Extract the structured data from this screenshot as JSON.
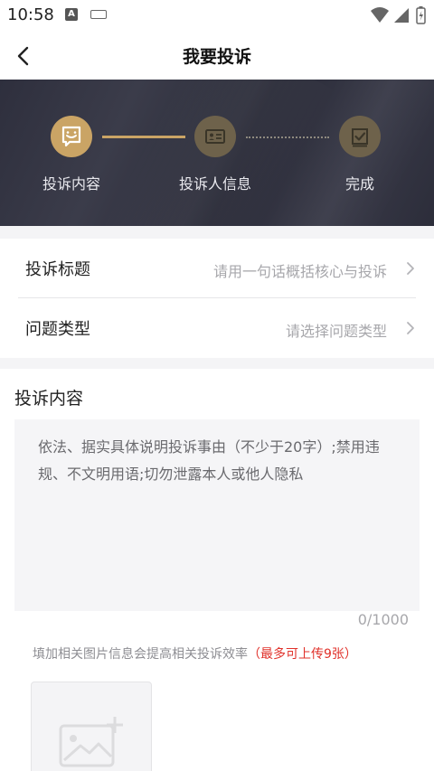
{
  "status_bar": {
    "time": "10:58",
    "a_badge": "A",
    "icons": [
      "a-badge-icon",
      "keyboard-icon",
      "wifi-icon",
      "signal-icon",
      "battery-icon"
    ]
  },
  "nav": {
    "title": "我要投诉",
    "back_icon": "chevron-left-icon"
  },
  "steps": [
    {
      "label": "投诉内容",
      "icon": "complaint-message-icon",
      "state": "active"
    },
    {
      "label": "投诉人信息",
      "icon": "id-card-icon",
      "state": "inactive"
    },
    {
      "label": "完成",
      "icon": "check-box-icon",
      "state": "inactive"
    }
  ],
  "form": {
    "title_row": {
      "label": "投诉标题",
      "placeholder": "请用一句话概括核心与投诉"
    },
    "type_row": {
      "label": "问题类型",
      "placeholder": "请选择问题类型"
    }
  },
  "content": {
    "section_title": "投诉内容",
    "textarea_placeholder": "依法、据实具体说明投诉事由（不少于20字）;禁用违规、不文明用语;切勿泄露本人或他人隐私",
    "textarea_value": "",
    "counter": "0/1000",
    "hint": "填加相关图片信息会提高相关投诉效率",
    "hint_red": "（最多可上传9张）",
    "upload_icon": "add-image-icon"
  },
  "colors": {
    "accent_gold": "#caa465",
    "banner_dark": "#2e2f3d",
    "warning_red": "#e0312a"
  }
}
